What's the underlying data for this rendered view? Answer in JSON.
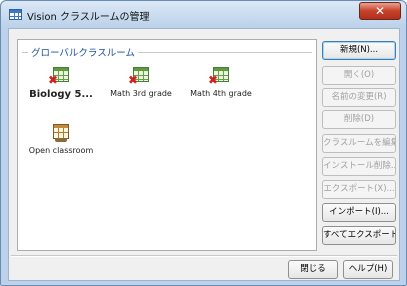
{
  "window": {
    "title": "Vision クラスルームの管理",
    "close_glyph": "✕"
  },
  "group": {
    "title": "グローバルクラスルーム"
  },
  "classrooms": [
    {
      "label": "Biology 5...",
      "status": "error",
      "icon": "classroom-grid-icon"
    },
    {
      "label": "Math 3rd grade",
      "status": "error",
      "icon": "classroom-grid-icon"
    },
    {
      "label": "Math 4th grade",
      "status": "error",
      "icon": "classroom-grid-icon"
    },
    {
      "label": "Open classroom",
      "status": "ok",
      "icon": "open-classroom-icon"
    }
  ],
  "buttons": {
    "new": "新規(N)...",
    "open": "開く(O)",
    "rename": "名前の変更(R)",
    "delete": "削除(D)",
    "edit_classroom": "クラスルームを編集(E)",
    "uninstall": "インストール削除...",
    "export": "エクスポート(X)...",
    "import": "インポート(I)...",
    "export_all": "すべてエクスポート(A)...",
    "close": "閉じる",
    "help": "ヘルプ(H)"
  },
  "colors": {
    "accent": "#1a4f9c",
    "error_mark": "#d4201c",
    "close_button": "#c7412a"
  }
}
